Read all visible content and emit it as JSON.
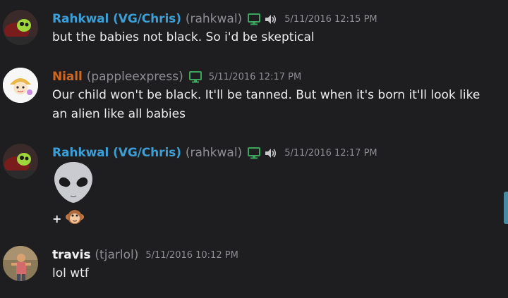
{
  "messages": [
    {
      "display_name": "Rahkwal (VG/Chris)",
      "username": "(rahkwal)",
      "name_color": "#3d9fd6",
      "badges": [
        "desktop-icon",
        "voice-icon"
      ],
      "timestamp": "5/11/2016 12:15 PM",
      "text": "but the babies not black. So i'd be skeptical"
    },
    {
      "display_name": "Niall",
      "username": "(pappleexpress)",
      "name_color": "#d0661f",
      "badges": [
        "desktop-icon"
      ],
      "timestamp": "5/11/2016 12:17 PM",
      "text": "Our child won't be black. It'll be tanned. But when it's born it'll look like an alien like all babies"
    },
    {
      "display_name": "Rahkwal (VG/Chris)",
      "username": "(rahkwal)",
      "name_color": "#3d9fd6",
      "badges": [
        "desktop-icon",
        "voice-icon"
      ],
      "timestamp": "5/11/2016 12:17 PM",
      "emoji": "alien-emoji",
      "reaction_plus": "+",
      "reaction_emoji": "monkey-face-emoji"
    },
    {
      "display_name": "travis",
      "username": "(tjarlol)",
      "name_color": "#f2f2f2",
      "badges": [],
      "timestamp": "5/11/2016 10:12 PM",
      "text": "lol wtf"
    }
  ],
  "colors": {
    "background": "#1e1e20",
    "badge_green": "#3ba55d",
    "muted_text": "#8e8e93",
    "scroll_accent": "#4a8aa0"
  }
}
